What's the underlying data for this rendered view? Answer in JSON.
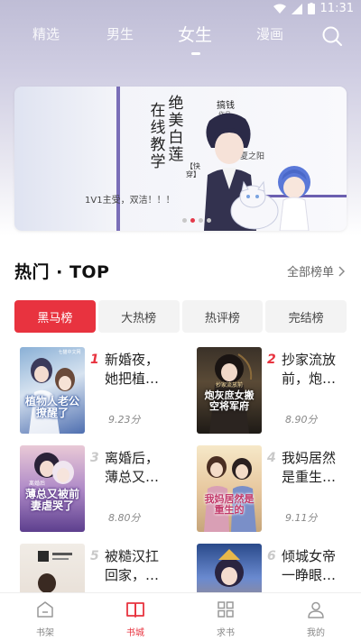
{
  "status": {
    "time": "11:31"
  },
  "top_tabs": [
    {
      "label": "精选"
    },
    {
      "label": "男生"
    },
    {
      "label": "女生",
      "active": true
    },
    {
      "label": "漫画"
    }
  ],
  "banner": {
    "title_col1": "在线教学",
    "title_col2": "绝美白莲",
    "tag": "【快穿】",
    "subtitle": "1V1主受，双洁！！！",
    "author": "搞钱",
    "author_sub": "作品",
    "author_note": "夏之阳",
    "slides": 4,
    "active_slide": 1
  },
  "section": {
    "title": "热门 · TOP",
    "all_label": "全部榜单"
  },
  "rank_tabs": [
    {
      "label": "黑马榜",
      "active": true
    },
    {
      "label": "大热榜"
    },
    {
      "label": "热评榜"
    },
    {
      "label": "完结榜"
    }
  ],
  "books": [
    {
      "rank": "1",
      "title": "新婚夜，她把植…",
      "score": "9.23分",
      "cover_text": "植物人老公撩醒了",
      "cover_sub": "七猫中文网"
    },
    {
      "rank": "2",
      "title": "抄家流放前，炮…",
      "score": "8.90分",
      "cover_text": "炮灰庶女搬空将军府",
      "cover_sub": "抄家流放前"
    },
    {
      "rank": "3",
      "title": "离婚后，薄总又…",
      "score": "8.80分",
      "cover_text": "薄总又被前妻虐哭了",
      "cover_sub": "离婚后"
    },
    {
      "rank": "4",
      "title": "我妈居然是重生…",
      "score": "9.11分",
      "cover_text": "我妈居然是重生的",
      "cover_sub": ""
    },
    {
      "rank": "5",
      "title": "被糙汉扛回家，…",
      "score": "",
      "cover_text": "",
      "cover_sub": ""
    },
    {
      "rank": "6",
      "title": "倾城女帝一睁眼…",
      "score": "",
      "cover_text": "倾城女帝",
      "cover_sub": ""
    }
  ],
  "bottom_nav": [
    {
      "label": "书架",
      "icon": "bookshelf-icon"
    },
    {
      "label": "书城",
      "icon": "book-open-icon",
      "active": true
    },
    {
      "label": "求书",
      "icon": "grid-icon"
    },
    {
      "label": "我的",
      "icon": "user-icon"
    }
  ],
  "colors": {
    "accent": "#e8333f",
    "rank_top": "#e8333f",
    "rank_other": "#c9c9c9",
    "header_bg": "#c4c2da"
  }
}
